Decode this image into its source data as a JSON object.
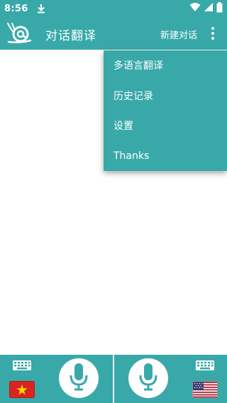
{
  "status_bar": {
    "time": "8:56",
    "icons": [
      "download-icon",
      "wifi-icon",
      "signal-icon",
      "battery-icon"
    ]
  },
  "app_bar": {
    "title": "对话翻译",
    "new_chat_label": "新建对话",
    "logo_icon": "snail-logo-icon",
    "overflow_icon": "more-vert-icon"
  },
  "menu": {
    "items": [
      {
        "label": "多语言翻译"
      },
      {
        "label": "历史记录"
      },
      {
        "label": "设置"
      },
      {
        "label": "Thanks"
      }
    ]
  },
  "bottom_bar": {
    "left": {
      "flag": "vietnam-flag-icon",
      "keyboard": "keyboard-icon",
      "mic": "mic-icon"
    },
    "right": {
      "flag": "usa-flag-icon",
      "keyboard": "keyboard-icon",
      "mic": "mic-icon"
    }
  },
  "colors": {
    "primary": "#38a9a8",
    "white": "#ffffff"
  }
}
